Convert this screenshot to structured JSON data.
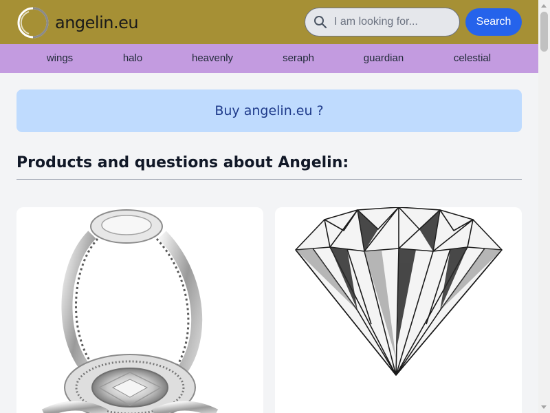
{
  "site": {
    "name": "angelin.eu",
    "logo_icon": "ring-logo-icon"
  },
  "search": {
    "placeholder": "I am looking for...",
    "value": "",
    "button_label": "Search",
    "icon": "search-icon"
  },
  "nav": {
    "items": [
      {
        "label": "wings"
      },
      {
        "label": "halo"
      },
      {
        "label": "heavenly"
      },
      {
        "label": "seraph"
      },
      {
        "label": "guardian"
      },
      {
        "label": "celestial"
      }
    ]
  },
  "banner": {
    "label": "Buy angelin.eu ?"
  },
  "section": {
    "title": "Products and questions about Angelin:"
  },
  "products": [
    {
      "image": "diamond-ring-image"
    },
    {
      "image": "diamond-sketch-image"
    }
  ],
  "colors": {
    "header": "#a69035",
    "nav": "#c39be0",
    "banner": "#bfdbfe",
    "accent": "#2563eb",
    "background": "#f3f4f6"
  }
}
